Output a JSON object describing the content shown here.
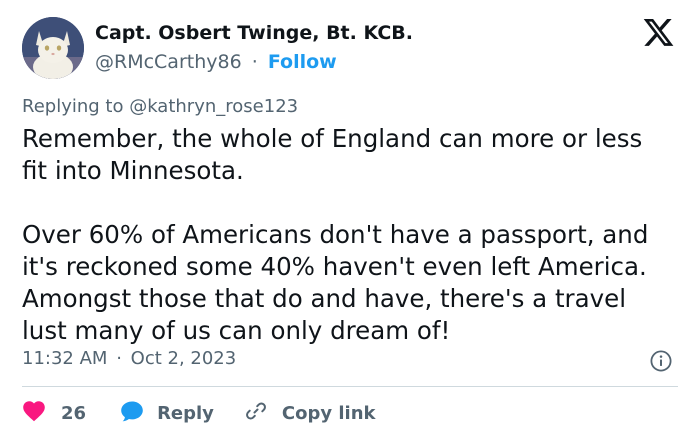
{
  "author": {
    "display_name": "Capt. Osbert Twinge, Bt. KCB.",
    "handle": "@RMcCarthy86",
    "separator": "·",
    "follow_label": "Follow"
  },
  "reply_context": {
    "prefix": "Replying to ",
    "handle": "@kathryn_rose123"
  },
  "tweet": {
    "text": "Remember, the whole of England can more or less\nfit into Minnesota.\n\nOver 60% of Americans don't have a passport, and\nit's reckoned some 40% haven't even left America.\nAmongst those that do and have, there's a travel\nlust many of us can only dream of!"
  },
  "meta": {
    "time": "11:32 AM",
    "separator": "·",
    "date": "Oct 2, 2023"
  },
  "actions": {
    "like_count": "26",
    "reply_label": "Reply",
    "copy_link_label": "Copy link"
  },
  "icons": {
    "brand": "x-logo-icon",
    "info": "info-icon",
    "like": "heart-icon",
    "reply": "speech-bubble-icon",
    "copy": "link-icon"
  },
  "colors": {
    "text_primary": "#0f1419",
    "text_secondary": "#536471",
    "accent": "#1d9bf0",
    "like": "#f91880",
    "divider": "#cfd9de"
  }
}
